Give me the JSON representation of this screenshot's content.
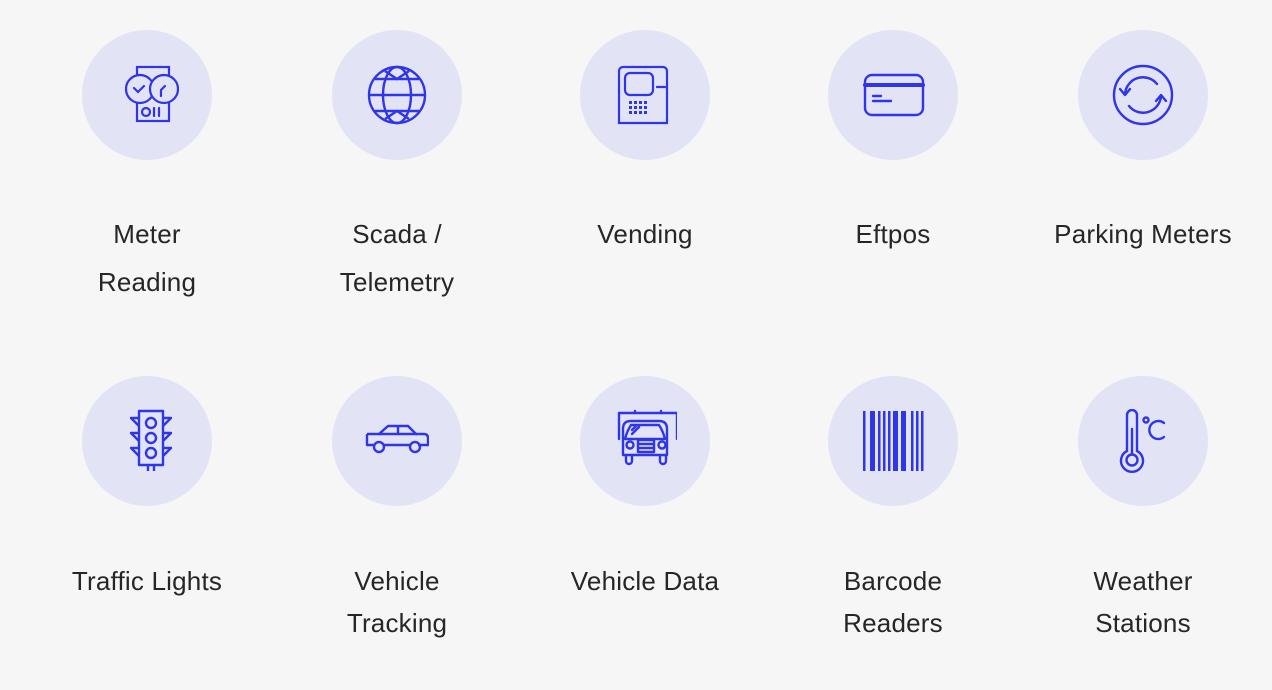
{
  "accent_color": "#2f35e8",
  "circle_color": "#e2e3f5",
  "items": [
    {
      "label_lines": [
        "Meter",
        "Reading"
      ],
      "icon": "meter-icon"
    },
    {
      "label_lines": [
        "Scada /",
        "Telemetry"
      ],
      "icon": "globe-icon"
    },
    {
      "label_lines": [
        "Vending"
      ],
      "icon": "vending-machine-icon"
    },
    {
      "label_lines": [
        "Eftpos"
      ],
      "icon": "credit-card-icon"
    },
    {
      "label_lines": [
        "Parking Meters"
      ],
      "icon": "refresh-cycle-icon"
    },
    {
      "label_lines": [
        "Traffic Lights"
      ],
      "icon": "traffic-light-icon"
    },
    {
      "label_lines": [
        "Vehicle",
        "Tracking"
      ],
      "icon": "car-icon"
    },
    {
      "label_lines": [
        "Vehicle Data"
      ],
      "icon": "truck-icon"
    },
    {
      "label_lines": [
        "Barcode",
        "Readers"
      ],
      "icon": "barcode-icon"
    },
    {
      "label_lines": [
        "Weather",
        "Stations"
      ],
      "icon": "thermometer-icon"
    }
  ]
}
